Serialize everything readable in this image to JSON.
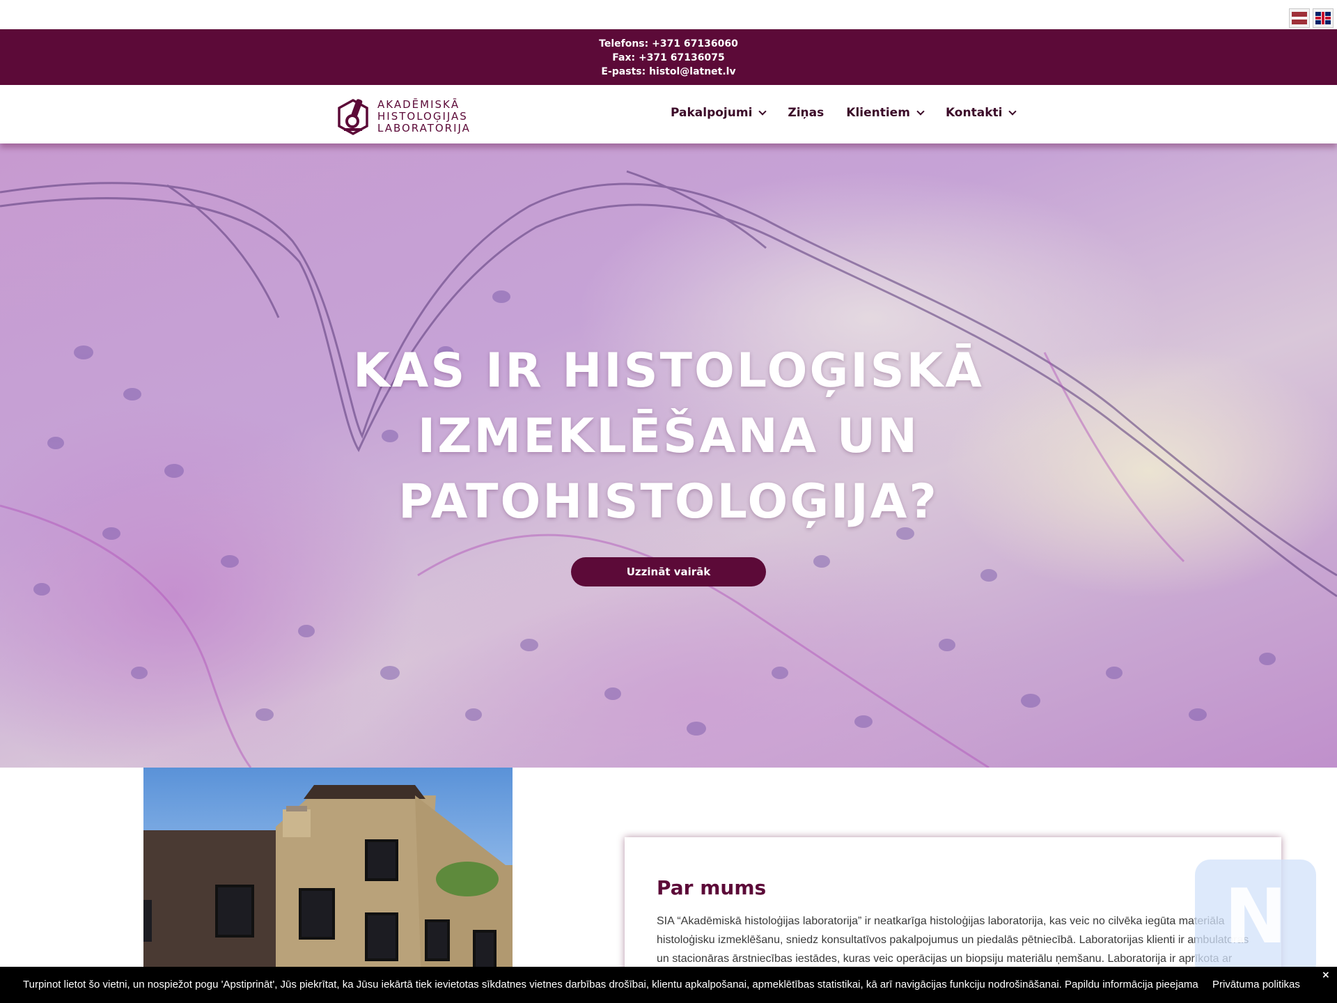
{
  "language_switcher": {
    "items": [
      {
        "code": "lv",
        "icon": "latvia-flag-icon"
      },
      {
        "code": "en",
        "icon": "uk-flag-icon"
      }
    ]
  },
  "contact": {
    "phone": "Telefons: +371 67136060",
    "fax": "Fax: +371 67136075",
    "email": "E-pasts: histol@latnet.lv"
  },
  "logo": {
    "icon": "microscope-hexagon-icon",
    "line1": "AKADĒMISKĀ",
    "line2": "HISTOLOĢIJAS",
    "line3": "LABORATORIJA"
  },
  "nav": {
    "items": [
      {
        "label": "Pakalpojumi",
        "has_dropdown": true
      },
      {
        "label": "Ziņas",
        "has_dropdown": false
      },
      {
        "label": "Klientiem",
        "has_dropdown": true
      },
      {
        "label": "Kontakti",
        "has_dropdown": true
      }
    ]
  },
  "hero": {
    "title_line1": "KAS IR HISTOLOĢISKĀ",
    "title_line2": "IZMEKLĒŠANA UN",
    "title_line3": "PATOHISTOLOĢIJA?",
    "button_label": "Uzzināt vairāk"
  },
  "about": {
    "title": "Par mums",
    "text": "SIA “Akadēmiskā histoloģijas laboratorija” ir neatkarīga histoloģijas laboratorija, kas veic no cilvēka iegūta materiāla histoloģisku izmeklēšanu, sniedz konsultatīvos pakalpojumus un piedalās pētniecībā. Laboratorijas klienti ir ambulatoras un stacionāras ārstniecības iestādes, kuras veic operācijas un biopsiju materiālu ņemšanu. Laboratorija ir aprīkota ar"
  },
  "cookie_bar": {
    "text": "Turpinot lietot šo vietni, un nospiežot pogu 'Apstiprināt', Jūs piekrītat, ka Jūsu iekārtā tiek ievietotas sīkdatnes vietnes darbības drošībai, klientu apkalpošanai, apmeklētības statistikai, kā arī navigācijas funkciju nodrošināšanai. Papildu informācija pieejama",
    "link": "Privātuma politikas",
    "close": "×"
  },
  "colors": {
    "brand": "#5c0a38",
    "nav_text": "#3b0a28",
    "cookie_bg": "#000000"
  }
}
